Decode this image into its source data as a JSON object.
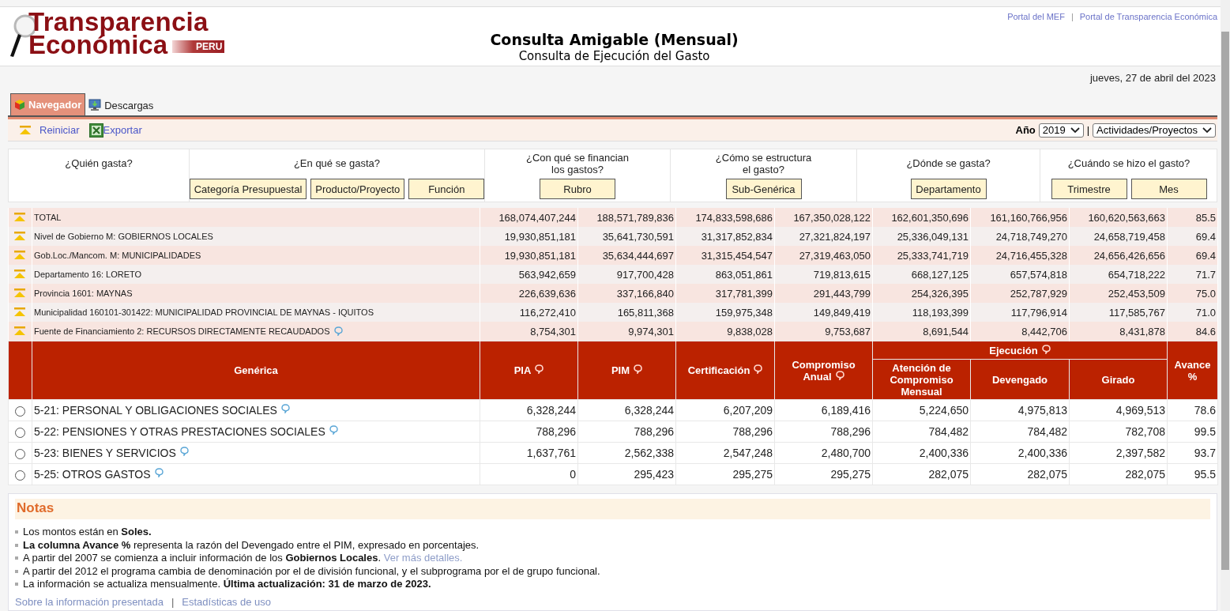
{
  "header": {
    "logo": {
      "line1": "Transparencia",
      "line2": "Económica",
      "badge": "PERU"
    },
    "links": [
      "Portal del MEF",
      "Portal de Transparencia Económica"
    ],
    "link_separator": "|",
    "title": "Consulta Amigable (Mensual)",
    "subtitle": "Consulta de Ejecución del Gasto"
  },
  "date": "jueves, 27 de abril del 2023",
  "tabs": [
    {
      "label": "Navegador",
      "selected": true
    },
    {
      "label": "Descargas",
      "selected": false
    }
  ],
  "toolbar": {
    "actions": [
      "Reiniciar",
      "Exportar"
    ],
    "year_label": "Año",
    "year": "2019",
    "separator": "|",
    "view": "Actividades/Proyectos"
  },
  "filters": [
    {
      "question": "¿Quién gasta?"
    },
    {
      "question": "¿En qué se gasta?",
      "buttons": [
        "Categoría Presupuestal",
        "Producto/Proyecto",
        "Función"
      ]
    },
    {
      "question": "¿Con qué se financian los gastos?",
      "buttons": [
        "Rubro"
      ]
    },
    {
      "question": "¿Cómo se estructura el gasto?",
      "buttons": [
        "Sub-Genérica"
      ]
    },
    {
      "question": "¿Dónde se gasta?",
      "buttons": [
        "Departamento"
      ]
    },
    {
      "question": "¿Cuándo se hizo el gasto?",
      "buttons": [
        "Trimestre",
        "Mes"
      ]
    }
  ],
  "breadcrumb": [
    {
      "label": "TOTAL",
      "info": false,
      "values": [
        "168,074,407,244",
        "188,571,789,836",
        "174,833,598,686",
        "167,350,028,122",
        "162,601,350,696",
        "161,160,766,956",
        "160,620,563,663",
        "85.5"
      ]
    },
    {
      "label": "Nivel de Gobierno M: GOBIERNOS LOCALES",
      "info": false,
      "values": [
        "19,930,851,181",
        "35,641,730,591",
        "31,317,852,834",
        "27,321,824,197",
        "25,336,049,131",
        "24,718,749,270",
        "24,658,719,458",
        "69.4"
      ]
    },
    {
      "label": "Gob.Loc./Mancom. M: MUNICIPALIDADES",
      "info": false,
      "values": [
        "19,930,851,181",
        "35,634,444,697",
        "31,315,454,547",
        "27,319,463,050",
        "25,333,741,719",
        "24,716,455,328",
        "24,656,426,656",
        "69.4"
      ]
    },
    {
      "label": "Departamento 16: LORETO",
      "info": false,
      "values": [
        "563,942,659",
        "917,700,428",
        "863,051,861",
        "719,813,615",
        "668,127,125",
        "657,574,818",
        "654,718,222",
        "71.7"
      ]
    },
    {
      "label": "Provincia 1601: MAYNAS",
      "info": false,
      "values": [
        "226,639,636",
        "337,166,840",
        "317,781,399",
        "291,443,799",
        "254,326,395",
        "252,787,929",
        "252,453,509",
        "75.0"
      ]
    },
    {
      "label": "Municipalidad 160101-301422: MUNICIPALIDAD PROVINCIAL DE MAYNAS - IQUITOS",
      "info": false,
      "values": [
        "116,272,410",
        "165,811,368",
        "159,975,348",
        "149,849,419",
        "118,193,399",
        "117,796,914",
        "117,585,767",
        "71.0"
      ]
    },
    {
      "label": "Fuente de Financiamiento 2: RECURSOS DIRECTAMENTE RECAUDADOS",
      "info": true,
      "values": [
        "8,754,301",
        "9,974,301",
        "9,838,028",
        "9,753,687",
        "8,691,544",
        "8,442,706",
        "8,431,878",
        "84.6"
      ]
    }
  ],
  "columns": [
    {
      "label": "Genérica",
      "info": false
    },
    {
      "label": "PIA",
      "info": true
    },
    {
      "label": "PIM",
      "info": true
    },
    {
      "label": "Certificación",
      "info": true
    },
    {
      "label": "Compromiso Anual",
      "info": true
    },
    {
      "label": "Ejecución",
      "info": true,
      "children": [
        {
          "label": "Atención de Compromiso Mensual",
          "info": false
        },
        {
          "label": "Devengado",
          "info": false
        },
        {
          "label": "Girado",
          "info": false
        }
      ]
    },
    {
      "label": "Avance %",
      "info": false
    }
  ],
  "rows": [
    {
      "label": "5-21: PERSONAL Y OBLIGACIONES SOCIALES",
      "selected": false,
      "info": true,
      "values": [
        "6,328,244",
        "6,328,244",
        "6,207,209",
        "6,189,416",
        "5,224,650",
        "4,975,813",
        "4,969,513",
        "78.6"
      ]
    },
    {
      "label": "5-22: PENSIONES Y OTRAS PRESTACIONES SOCIALES",
      "selected": false,
      "info": true,
      "values": [
        "788,296",
        "788,296",
        "788,296",
        "788,296",
        "784,482",
        "784,482",
        "782,708",
        "99.5"
      ]
    },
    {
      "label": "5-23: BIENES Y SERVICIOS",
      "selected": false,
      "info": true,
      "values": [
        "1,637,761",
        "2,562,338",
        "2,547,248",
        "2,480,700",
        "2,400,336",
        "2,400,336",
        "2,397,582",
        "93.7"
      ]
    },
    {
      "label": "5-25: OTROS GASTOS",
      "selected": false,
      "info": true,
      "values": [
        "0",
        "295,423",
        "295,275",
        "295,275",
        "282,075",
        "282,075",
        "282,075",
        "95.5"
      ]
    }
  ],
  "notes": {
    "title": "Notas",
    "items": [
      {
        "text": "Los montos están en **Soles.**"
      },
      {
        "text": "**La columna Avance %** representa la razón del Devengado entre el PIM, expresado en porcentajes."
      },
      {
        "text": "A partir del 2007 se comienza a incluir información de los **Gobiernos Locales**.",
        "link": "Ver más detalles."
      },
      {
        "text": "A partir del 2012 el programa cambia de denominación por el de división funcional, y el subprograma por el de grupo funcional."
      },
      {
        "text": "La información se actualiza mensualmente. **Última actualización: 31 de marzo de 2023.**"
      }
    ],
    "footer_links": [
      "Sobre la información presentada",
      "Estadísticas de uso"
    ],
    "footer_separator": "|"
  }
}
